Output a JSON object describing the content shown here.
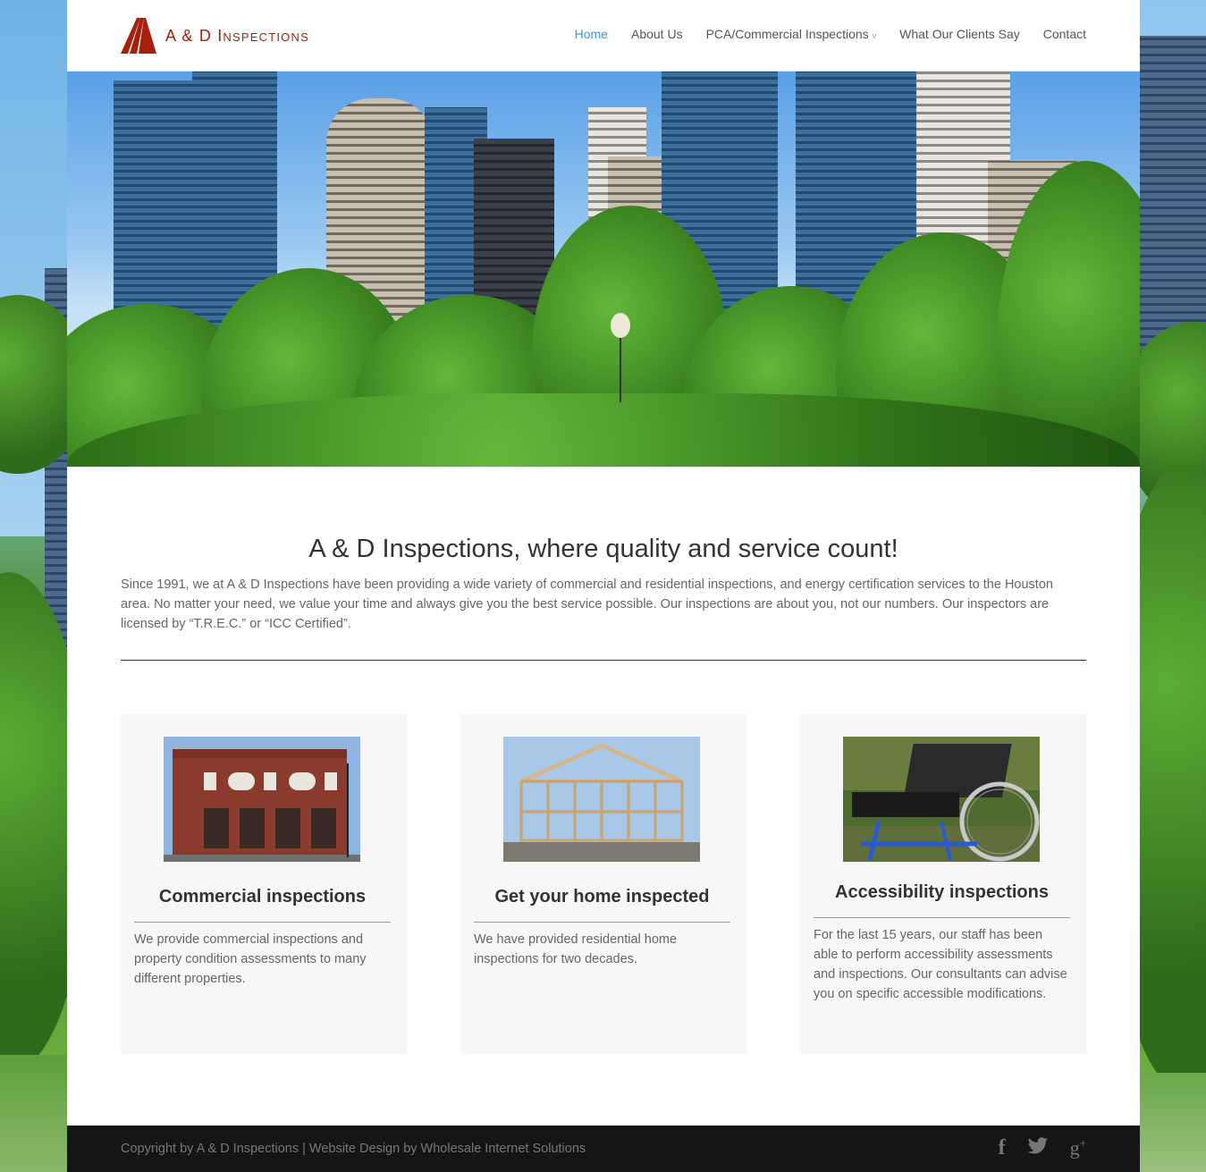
{
  "brand": {
    "name": "A & D Inspections"
  },
  "nav": {
    "items": [
      {
        "label": "Home",
        "active": true
      },
      {
        "label": "About Us"
      },
      {
        "label": "PCA/Commercial Inspections",
        "has_dropdown": true
      },
      {
        "label": "What Our Clients Say"
      },
      {
        "label": "Contact"
      }
    ],
    "dropdown_caret": "v"
  },
  "intro": {
    "title": "A & D Inspections, where quality and service count!",
    "body": "Since 1991, we at A & D Inspections have been providing a wide variety of commercial and residential inspections, and energy certification services to the Houston area. No matter your need, we value your time and always give you the best service possible. Our inspections are about you, not our numbers. Our inspectors are licensed by “T.R.E.C.”  or “ICC Certified”."
  },
  "cards": [
    {
      "title": "Commercial inspections",
      "text": "We provide commercial inspections and property condition assessments to many different properties.",
      "image": "brick-building"
    },
    {
      "title": "Get your home inspected",
      "text": "We have provided residential home inspections for two decades.",
      "image": "house-framing"
    },
    {
      "title": "Accessibility inspections",
      "text": "For the last 15 years, our staff has been able to perform accessibility assessments and inspections. Our consultants can advise you on specific accessible modifications.",
      "image": "wheelchair"
    }
  ],
  "footer": {
    "copyright": "Copyright by A & D Inspections | Website Design by Wholesale Internet Solutions",
    "social": [
      {
        "icon": "facebook-icon",
        "glyph": "f"
      },
      {
        "icon": "twitter-icon",
        "glyph": "🐦"
      },
      {
        "icon": "google-plus-icon",
        "glyph": "g+"
      }
    ]
  },
  "colors": {
    "brand_red": "#a4210d",
    "nav_active": "#4a90d9",
    "footer_bg": "#151515"
  }
}
